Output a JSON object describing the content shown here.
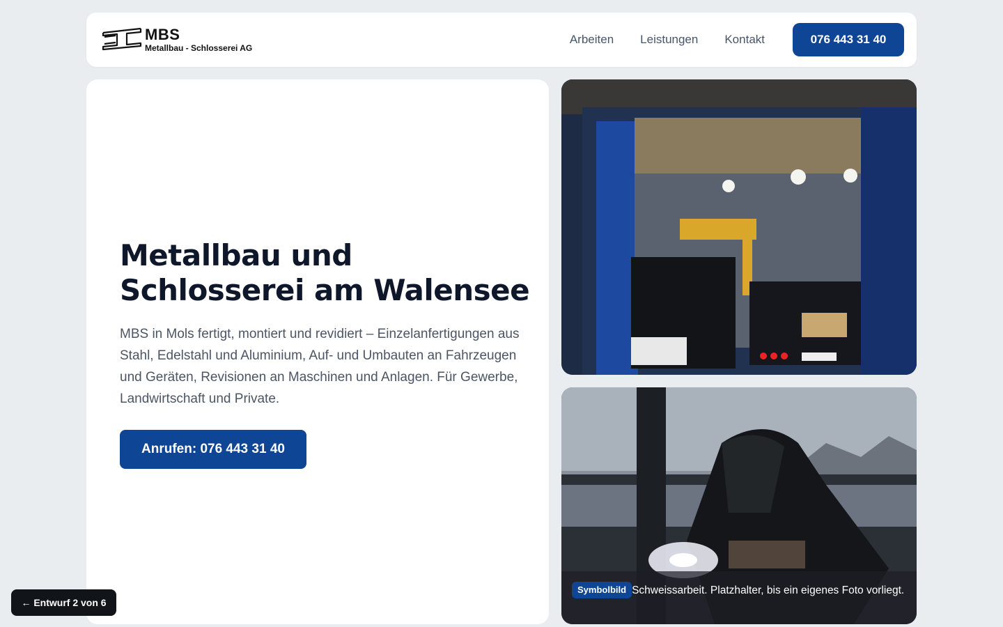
{
  "header": {
    "logo": {
      "name": "MBS",
      "subtitle": "Metallbau - Schlosserei AG"
    },
    "nav": [
      {
        "label": "Arbeiten"
      },
      {
        "label": "Leistungen"
      },
      {
        "label": "Kontakt"
      }
    ],
    "phone_button": "076 443 31 40"
  },
  "hero": {
    "title": "Metallbau und Schlosserei am Walensee",
    "text": "MBS in Mols fertigt, montiert und revidiert – Einzelanfertigungen aus Stahl, Edelstahl und Aluminium, Auf- und Umbauten an Fahrzeugen und Geräten, Revisionen an Maschinen und Anlagen. Für Gewerbe, Landwirtschaft und Private.",
    "cta": "Anrufen: 076 443 31 40"
  },
  "photos": {
    "workshop": {
      "icon": "workshop-photo"
    },
    "welding": {
      "icon": "welding-photo",
      "badge": "Symbolbild",
      "caption": "Schweissarbeit. Platzhalter, bis ein eigenes Foto vorliegt."
    }
  },
  "toast": {
    "label": "← Entwurf 2 von 6"
  },
  "colors": {
    "accent": "#0f4595",
    "page_bg": "#e9edf0",
    "card_bg": "#ffffff"
  }
}
